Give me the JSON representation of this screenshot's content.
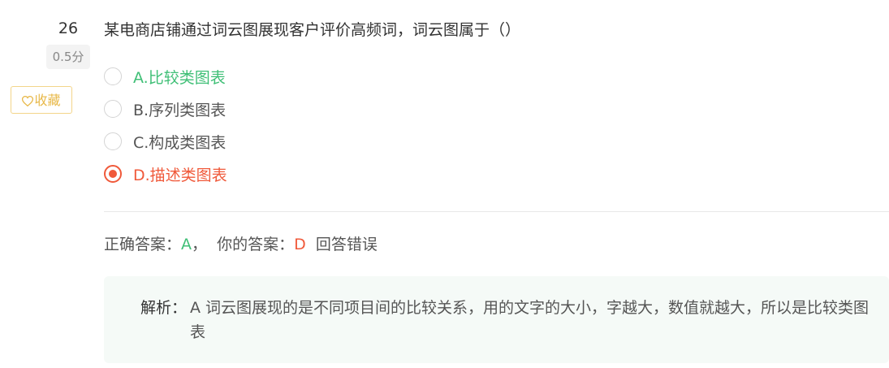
{
  "question": {
    "number": "26",
    "score": "0.5分",
    "favorite_label": "收藏",
    "text": "某电商店铺通过词云图展现客户评价高频词，词云图属于（）",
    "options": [
      {
        "label": "A.比较类图表",
        "state": "correct"
      },
      {
        "label": "B.序列类图表",
        "state": "normal"
      },
      {
        "label": "C.构成类图表",
        "state": "normal"
      },
      {
        "label": "D.描述类图表",
        "state": "selected-wrong"
      }
    ]
  },
  "result": {
    "correct_prefix": "正确答案：",
    "correct_answer": "A",
    "separator": "，  ",
    "your_prefix": "你的答案：",
    "your_answer": "D",
    "status": "回答错误"
  },
  "explanation": {
    "label": "解析：",
    "text": "A 词云图展现的是不同项目间的比较关系，用的文字的大小，字越大，数值就越大，所以是比较类图表"
  },
  "colors": {
    "correct": "#3fbf76",
    "wrong": "#f0593a",
    "favorite": "#e8b94a"
  }
}
